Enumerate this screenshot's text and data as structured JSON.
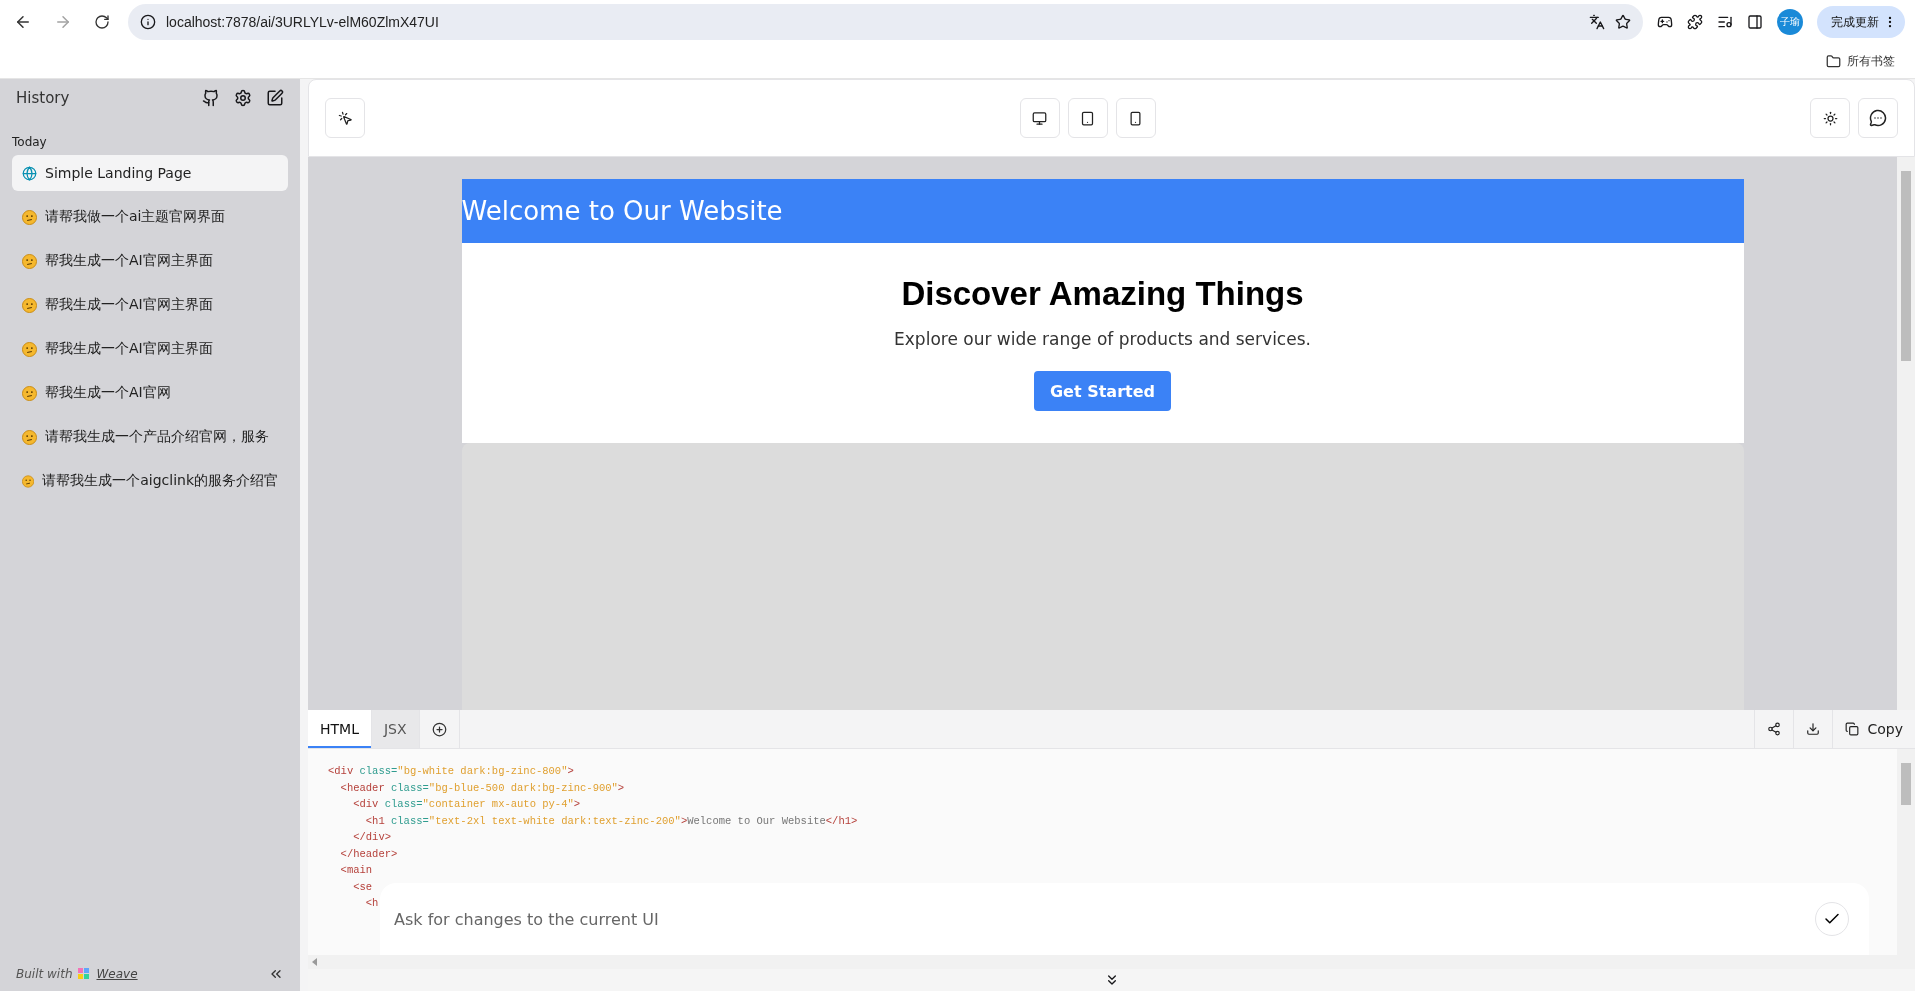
{
  "browser": {
    "url": "localhost:7878/ai/3URLYLv-elM60ZlmX47UI",
    "forward_disabled": true,
    "profile": "子瑜",
    "update_button": "完成更新",
    "bookmarks_folder": "所有书签"
  },
  "sidebar": {
    "title": "History",
    "section": "Today",
    "items": [
      {
        "label": "Simple Landing Page",
        "selected": true,
        "kind": "globe"
      },
      {
        "label": "请帮我做一个ai主题官网界面",
        "selected": false,
        "kind": "thinking"
      },
      {
        "label": "帮我生成一个AI官网主界面",
        "selected": false,
        "kind": "thinking"
      },
      {
        "label": "帮我生成一个AI官网主界面",
        "selected": false,
        "kind": "thinking"
      },
      {
        "label": "帮我生成一个AI官网主界面",
        "selected": false,
        "kind": "thinking"
      },
      {
        "label": "帮我生成一个AI官网",
        "selected": false,
        "kind": "thinking"
      },
      {
        "label": "请帮我生成一个产品介绍官网，服务",
        "selected": false,
        "kind": "thinking"
      },
      {
        "label": "请帮我生成一个aigclink的服务介绍官",
        "selected": false,
        "kind": "thinking"
      }
    ],
    "built_with": "Built with",
    "link": "Weave"
  },
  "preview": {
    "header": "Welcome to Our Website",
    "title": "Discover Amazing Things",
    "subtitle": "Explore our wide range of products and services.",
    "button": "Get Started"
  },
  "code_panel": {
    "tabs": [
      {
        "label": "HTML",
        "selected": true
      },
      {
        "label": "JSX",
        "selected": false
      }
    ],
    "copy_button": "Copy",
    "lines": [
      {
        "tokens": [
          {
            "kind": "tag",
            "text": "<div"
          },
          {
            "kind": "attr",
            "text": " class="
          },
          {
            "kind": "string",
            "text": "\"bg-white dark:bg-zinc-800\""
          },
          {
            "kind": "tag",
            "text": ">"
          }
        ]
      },
      {
        "tokens": [
          {
            "kind": "tag",
            "text": "  <header"
          },
          {
            "kind": "attr",
            "text": " class="
          },
          {
            "kind": "string",
            "text": "\"bg-blue-500 dark:bg-zinc-900\""
          },
          {
            "kind": "tag",
            "text": ">"
          }
        ]
      },
      {
        "tokens": [
          {
            "kind": "tag",
            "text": "    <div"
          },
          {
            "kind": "attr",
            "text": " class="
          },
          {
            "kind": "string",
            "text": "\"container mx-auto py-4\""
          },
          {
            "kind": "tag",
            "text": ">"
          }
        ]
      },
      {
        "tokens": [
          {
            "kind": "tag",
            "text": "      <h1"
          },
          {
            "kind": "attr",
            "text": " class="
          },
          {
            "kind": "string",
            "text": "\"text-2xl text-white dark:text-zinc-200\""
          },
          {
            "kind": "tag",
            "text": ">"
          },
          {
            "kind": "text",
            "text": "Welcome to Our Website"
          },
          {
            "kind": "tag",
            "text": "</h1>"
          }
        ]
      },
      {
        "tokens": [
          {
            "kind": "tag",
            "text": "    </div>"
          }
        ]
      },
      {
        "tokens": [
          {
            "kind": "tag",
            "text": "  </header>"
          }
        ]
      },
      {
        "tokens": [
          {
            "kind": "tag",
            "text": "  <main"
          }
        ]
      },
      {
        "tokens": [
          {
            "kind": "tag",
            "text": "    <se"
          }
        ]
      },
      {
        "tokens": [
          {
            "kind": "tag",
            "text": "      <h"
          }
        ]
      }
    ]
  },
  "prompt": {
    "placeholder": "Ask for changes to the current UI"
  }
}
